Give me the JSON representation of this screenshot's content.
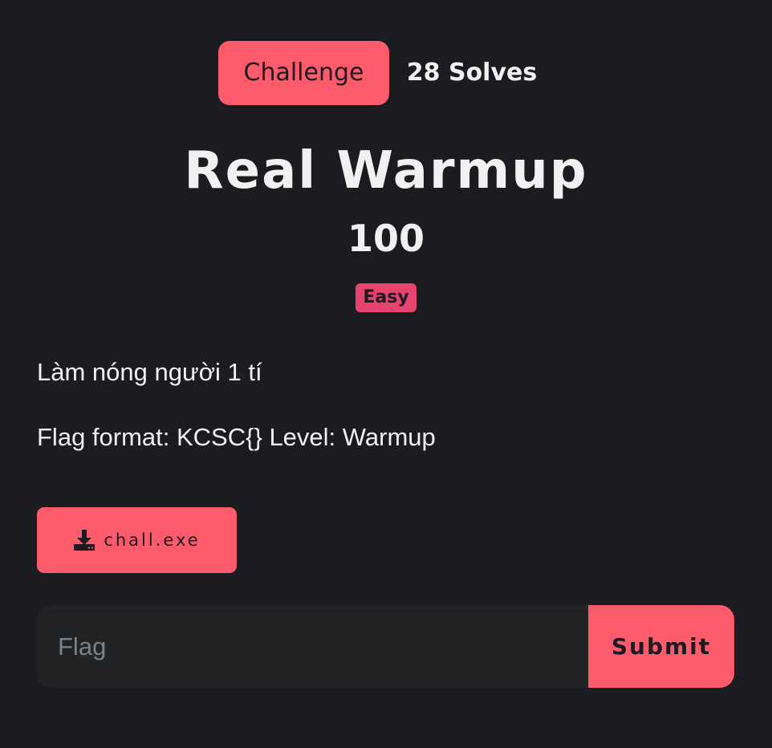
{
  "tabs": {
    "challenge_label": "Challenge",
    "solves_label": "28 Solves"
  },
  "challenge": {
    "title": "Real Warmup",
    "points": "100",
    "difficulty": "Easy",
    "description": [
      "Làm nóng người 1 tí",
      "Flag format: KCSC{} Level: Warmup"
    ]
  },
  "file": {
    "icon": "download-icon",
    "name": "chall.exe"
  },
  "flag_form": {
    "placeholder": "Flag",
    "value": "",
    "submit_label": "Submit"
  },
  "colors": {
    "background": "#1b1c20",
    "accent": "#fc5b6c",
    "badge": "#e6436f",
    "input_bg": "#222325",
    "text": "#f1f1f1"
  }
}
